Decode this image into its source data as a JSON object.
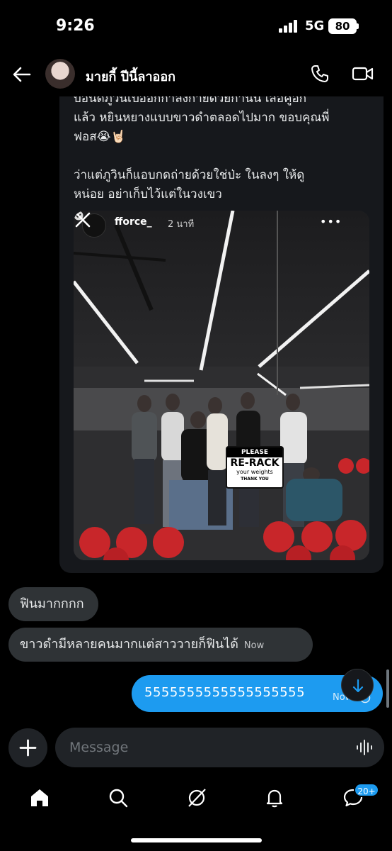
{
  "status_bar": {
    "time": "9:26",
    "network": "5G",
    "battery": "80"
  },
  "header": {
    "contact_name": "มายกี้ ปีนี้ลาออก",
    "icons": [
      "back-arrow-icon",
      "phone-icon",
      "video-camera-icon"
    ]
  },
  "quoted_message": {
    "text": "บอนดภูวนเปออกกาลงกายดวยกานน เสอคูอก\nแล้ว หยินหยางแบบขาวดำตลอดไปมาก ขอบคุณพี่\nฟอส😭🤘🏻\n\nว่าแต่ภูวินก็แอบกดถ่ายด้วยใช่ป่ะ ในลงๆ ให้ดู\nหน่อย อย่าเก็บไว้แต่ในวงเขว"
  },
  "story": {
    "username": "fforce_",
    "time": "2 นาที",
    "more": "•••",
    "sign": {
      "line1": "PLEASE",
      "line2": "RE-RACK",
      "line3": "your weights",
      "line4": "THANK YOU"
    }
  },
  "messages": {
    "received_1": "ฟินมากกกก",
    "received_2": "ขาวดำมีหลายคนมากแต่สาววายก็ฟินได้",
    "received_2_time": "Now",
    "sent_1": "5555555555555555555",
    "sent_1_time": "Now"
  },
  "composer": {
    "placeholder": "Message"
  },
  "bottom_nav": {
    "items": [
      "home-icon",
      "search-icon",
      "grok-icon",
      "notifications-icon",
      "messages-icon"
    ],
    "messages_badge": "20+"
  },
  "colors": {
    "background": "#000000",
    "bubble_received": "#2f3336",
    "bubble_sent": "#1d9bf0",
    "card": "#16181c"
  }
}
